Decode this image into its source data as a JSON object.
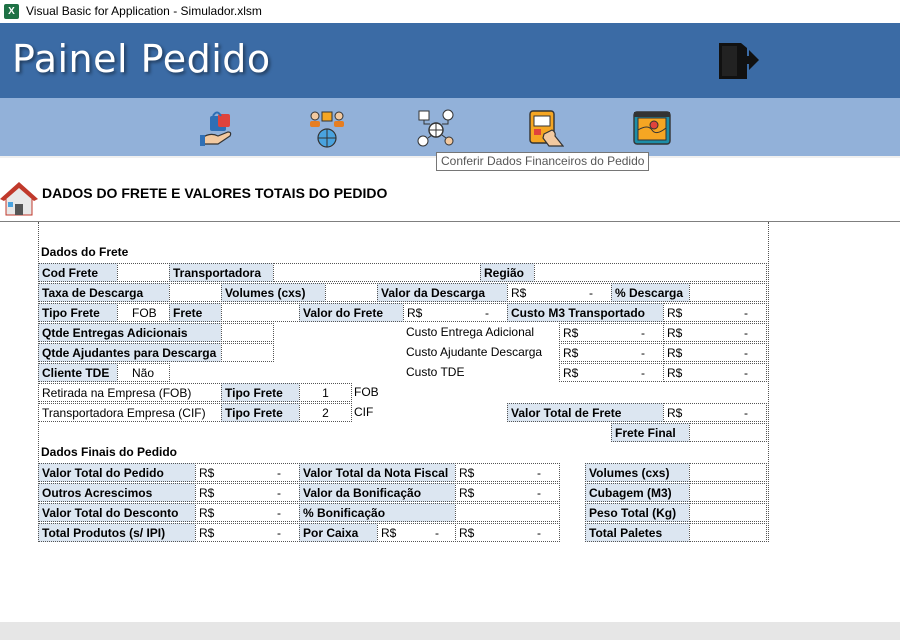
{
  "window": {
    "title": "Visual Basic for Application - Simulador.xlsm"
  },
  "header": {
    "title": "Painel Pedido",
    "exit_icon": "exit-door-icon"
  },
  "toolbar": {
    "buttons": [
      {
        "icon": "shopping-bag-hand-icon"
      },
      {
        "icon": "people-globe-icon"
      },
      {
        "icon": "financial-network-icon"
      },
      {
        "icon": "tablet-touch-icon"
      },
      {
        "icon": "map-location-icon"
      }
    ],
    "tooltip": "Conferir Dados Financeiros do Pedido"
  },
  "section": {
    "title": "DADOS DO FRETE E VALORES TOTAIS DO PEDIDO",
    "icon": "home-icon"
  },
  "frete": {
    "header": "Dados do Frete",
    "cod_frete": {
      "label": "Cod Frete",
      "value": ""
    },
    "transportadora": {
      "label": "Transportadora",
      "value": ""
    },
    "regiao": {
      "label": "Região",
      "value": ""
    },
    "taxa_descarga": {
      "label": "Taxa de Descarga",
      "value": ""
    },
    "volumes": {
      "label": "Volumes (cxs)",
      "value": ""
    },
    "valor_descarga": {
      "label": "Valor da Descarga",
      "currency": "R$",
      "value": "-"
    },
    "pct_descarga": {
      "label": "% Descarga",
      "value": ""
    },
    "tipo_frete": {
      "label": "Tipo Frete",
      "value": "FOB"
    },
    "frete": {
      "label": "Frete",
      "value": ""
    },
    "valor_frete": {
      "label": "Valor do Frete",
      "currency": "R$",
      "value": "-"
    },
    "custo_m3": {
      "label": "Custo M3 Transportado",
      "currency": "R$",
      "value": "-"
    },
    "qtde_entregas": {
      "label": "Qtde Entregas Adicionais",
      "value": ""
    },
    "qtde_ajudantes": {
      "label": "Qtde Ajudantes para Descarga",
      "value": ""
    },
    "cliente_tde": {
      "label": "Cliente TDE",
      "value": "Não"
    },
    "custo_entrega": {
      "label": "Custo Entrega Adicional",
      "currency": "R$",
      "value1": "-",
      "value2": "-"
    },
    "custo_ajudante": {
      "label": "Custo Ajudante Descarga",
      "currency": "R$",
      "value1": "-",
      "value2": "-"
    },
    "custo_tde": {
      "label": "Custo TDE",
      "currency": "R$",
      "value1": "-",
      "value2": "-"
    },
    "retirada": {
      "label": "Retirada na Empresa (FOB)",
      "tipo_label": "Tipo Frete",
      "num": "1",
      "code": "FOB"
    },
    "transp_empresa": {
      "label": "Transportadora Empresa (CIF)",
      "tipo_label": "Tipo Frete",
      "num": "2",
      "code": "CIF"
    },
    "valor_total_frete": {
      "label": "Valor Total de Frete",
      "currency": "R$",
      "value": "-"
    },
    "frete_final": {
      "label": "Frete Final",
      "value": ""
    }
  },
  "finais": {
    "header": "Dados Finais do Pedido",
    "valor_total_pedido": {
      "label": "Valor Total do Pedido",
      "currency": "R$",
      "value": "-"
    },
    "outros_acrescimos": {
      "label": "Outros Acrescimos",
      "currency": "R$",
      "value": "-"
    },
    "valor_total_desconto": {
      "label": "Valor Total do Desconto",
      "currency": "R$",
      "value": "-"
    },
    "total_produtos": {
      "label": "Total Produtos (s/ IPI)",
      "currency": "R$",
      "value": "-"
    },
    "valor_nota_fiscal": {
      "label": "Valor Total da Nota Fiscal",
      "currency": "R$",
      "value": "-"
    },
    "valor_bonificacao": {
      "label": "Valor da Bonificação",
      "currency": "R$",
      "value": "-"
    },
    "pct_bonificacao": {
      "label": "% Bonificação",
      "value": ""
    },
    "por_caixa": {
      "label": "Por Caixa",
      "currency": "R$",
      "value1": "-",
      "value2": "-"
    },
    "volumes": {
      "label": "Volumes (cxs)",
      "value": ""
    },
    "cubagem": {
      "label": "Cubagem (M3)",
      "value": ""
    },
    "peso_total": {
      "label": "Peso Total (Kg)",
      "value": ""
    },
    "total_paletes": {
      "label": "Total Paletes",
      "value": ""
    }
  },
  "colors": {
    "header_bg": "#3b6ba5",
    "toolbar_bg": "#92b1d9",
    "label_bg": "#dce6f1"
  }
}
